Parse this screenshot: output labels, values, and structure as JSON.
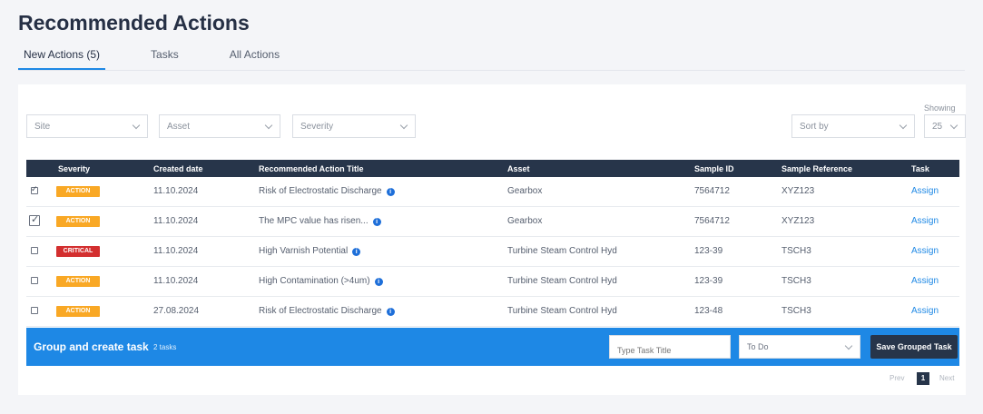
{
  "page": {
    "title": "Recommended Actions"
  },
  "tabs": [
    {
      "label": "New Actions (5)",
      "active": true
    },
    {
      "label": "Tasks",
      "active": false
    },
    {
      "label": "All Actions",
      "active": false
    }
  ],
  "filters": {
    "site": "Site",
    "asset": "Asset",
    "severity": "Severity",
    "sort": "Sort by",
    "showing_label": "Showing",
    "showing_value": "25"
  },
  "table": {
    "columns": [
      "Severity",
      "Created date",
      "Recommended Action Title",
      "Asset",
      "Sample ID",
      "Sample Reference",
      "Task"
    ],
    "rows": [
      {
        "checked": true,
        "severity": "ACTION",
        "date": "11.10.2024",
        "title": "Risk of Electrostatic Discharge",
        "asset": "Gearbox",
        "sample_id": "7564712",
        "sample_ref": "XYZ123",
        "task": "Assign"
      },
      {
        "checked": true,
        "severity": "ACTION",
        "date": "11.10.2024",
        "title": "The MPC value has risen...",
        "asset": "Gearbox",
        "sample_id": "7564712",
        "sample_ref": "XYZ123",
        "task": "Assign"
      },
      {
        "checked": false,
        "severity": "CRITICAL",
        "date": "11.10.2024",
        "title": "High Varnish Potential",
        "asset": "Turbine Steam Control Hyd",
        "sample_id": "123-39",
        "sample_ref": "TSCH3",
        "task": "Assign"
      },
      {
        "checked": false,
        "severity": "ACTION",
        "date": "11.10.2024",
        "title": "High Contamination (>4um)",
        "asset": "Turbine Steam Control Hyd",
        "sample_id": "123-39",
        "sample_ref": "TSCH3",
        "task": "Assign"
      },
      {
        "checked": false,
        "severity": "ACTION",
        "date": "27.08.2024",
        "title": "Risk of Electrostatic Discharge",
        "asset": "Turbine Steam Control Hyd",
        "sample_id": "123-48",
        "sample_ref": "TSCH3",
        "task": "Assign"
      }
    ]
  },
  "group": {
    "title": "Group and create task",
    "count": "2 tasks",
    "task_placeholder": "Type Task Title",
    "status_value": "To Do",
    "save_label": "Save Grouped Task"
  },
  "pager": {
    "prev": "Prev",
    "current": "1",
    "next": "Next"
  },
  "colors": {
    "accent": "#1e88e5",
    "header": "#27354a",
    "action": "#f9a825",
    "critical": "#d32f2f"
  }
}
